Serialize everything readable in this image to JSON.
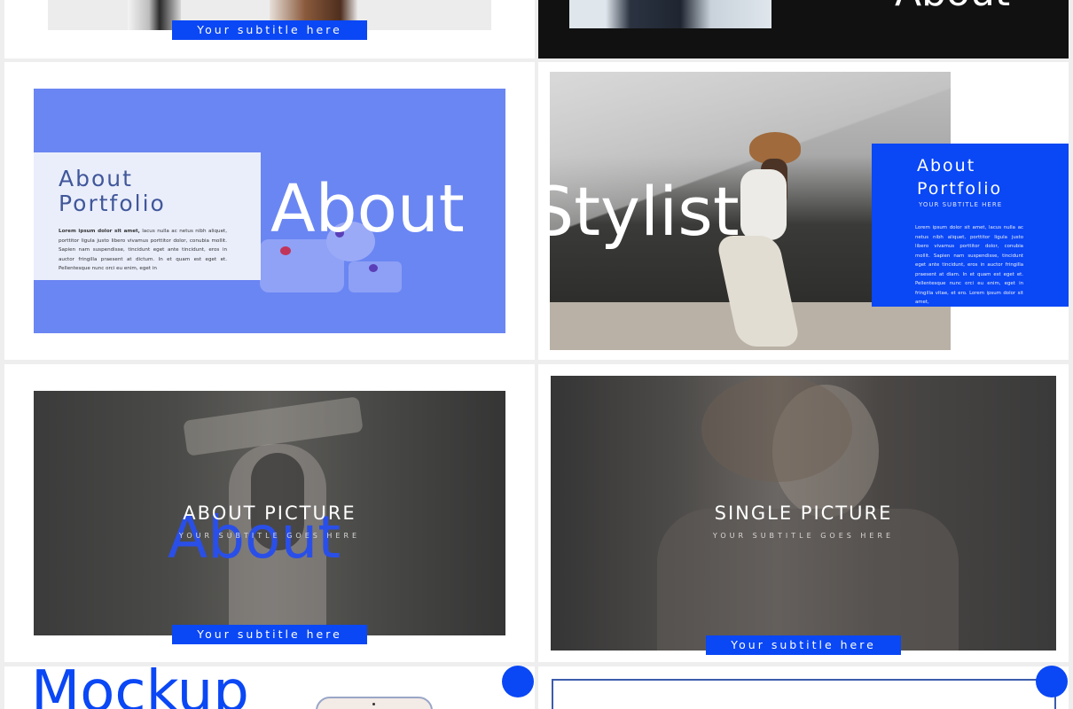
{
  "slides": {
    "top_left": {
      "subtitle": "Your subtitle here"
    },
    "top_right": {
      "big_word": "About"
    },
    "about_portfolio": {
      "heading_line1": "About",
      "heading_line2": "Portfolio",
      "body_bold": "Lorem ipsum dolor sit amet,",
      "body_text": " lacus nulla ac netus nibh aliquet, porttitor ligula justo libero vivamus porttitor dolor, conubia mollit. Sapien nam suspendisse, tincidunt eget ante tincidunt, eros in auctor fringilla praesent at dictum. In et quam est eget et. Pellentesque nunc orci eu enim, eget in",
      "big_word": "About"
    },
    "stylist": {
      "big_word": "Stylist",
      "heading_line1": "About",
      "heading_line2": "Portfolio",
      "small_caps": "YOUR SUBTITLE HERE",
      "body_text": "Lorem ipsum dolor sit amet, lacus nulla ac netus nibh aliquet, porttitor ligula justo libero vivamus porttitor dolor, conubia mollit. Sapien nam suspendisse, tincidunt eget ante tincidunt, eros in auctor fringilla praesent at diam. In et quam est eget et. Pellentesque nunc orci eu enim, eget in fringilla vitae, et ero. Lorem ipsum dolor sit amet,"
    },
    "about_picture": {
      "title": "ABOUT PICTURE",
      "small_caps": "YOUR SUBTITLE GOES HERE",
      "overlay_word": "About",
      "subtitle": "Your subtitle here"
    },
    "single_picture": {
      "title": "SINGLE PICTURE",
      "small_caps": "YOUR SUBTITLE GOES HERE",
      "subtitle": "Your subtitle here"
    },
    "mockup": {
      "big_word": "Mockup"
    }
  },
  "colors": {
    "accent": "#0a47f5",
    "periwinkle": "#6a86f3",
    "dark": "#111111"
  }
}
